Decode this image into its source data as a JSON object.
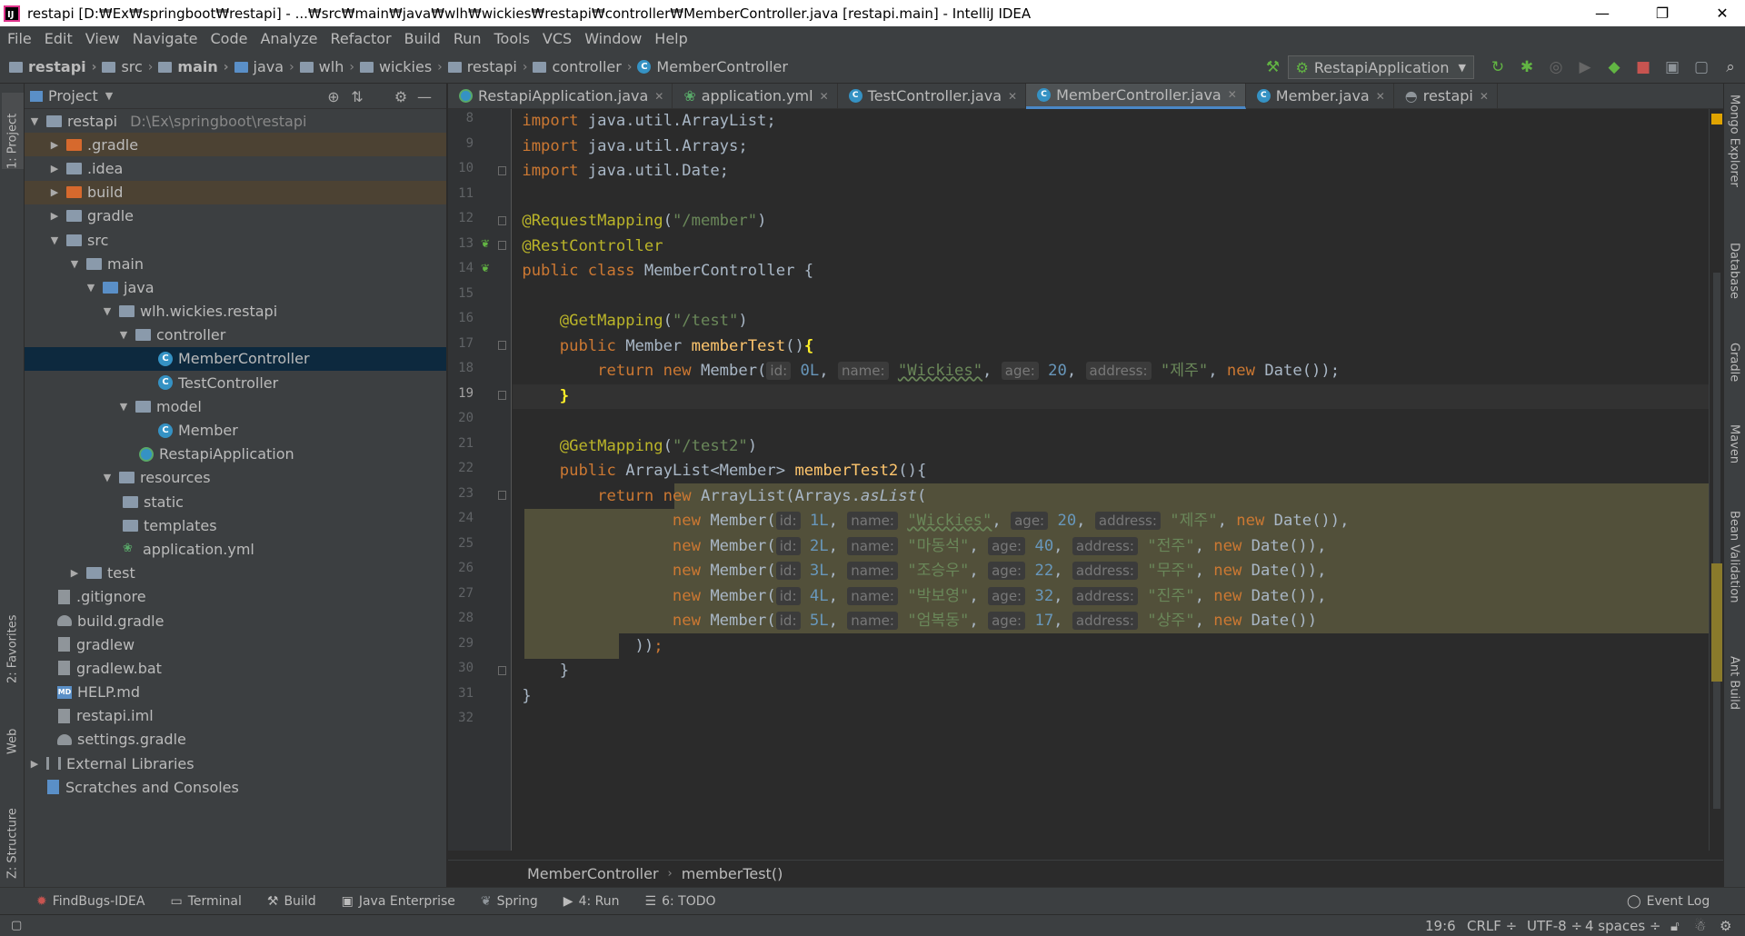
{
  "window": {
    "title": "restapi [D:₩Ex₩springboot₩restapi] - ...₩src₩main₩java₩wlh₩wickies₩restapi₩controller₩MemberController.java [restapi.main] - IntelliJ IDEA",
    "minimize": "—",
    "maximize": "❐",
    "close": "✕"
  },
  "menu": [
    "File",
    "Edit",
    "View",
    "Navigate",
    "Code",
    "Analyze",
    "Refactor",
    "Build",
    "Run",
    "Tools",
    "VCS",
    "Window",
    "Help"
  ],
  "nav_breadcrumb": [
    "restapi",
    "src",
    "main",
    "java",
    "wlh",
    "wickies",
    "restapi",
    "controller",
    "MemberController"
  ],
  "run_config": "RestapiApplication",
  "project_panel": {
    "title": "Project",
    "tree": [
      {
        "label": "restapi",
        "path": "D:\\Ex\\springboot\\restapi"
      },
      {
        "label": ".gradle"
      },
      {
        "label": ".idea"
      },
      {
        "label": "build"
      },
      {
        "label": "gradle"
      },
      {
        "label": "src"
      },
      {
        "label": "main"
      },
      {
        "label": "java"
      },
      {
        "label": "wlh.wickies.restapi"
      },
      {
        "label": "controller"
      },
      {
        "label": "MemberController"
      },
      {
        "label": "TestController"
      },
      {
        "label": "model"
      },
      {
        "label": "Member"
      },
      {
        "label": "RestapiApplication"
      },
      {
        "label": "resources"
      },
      {
        "label": "static"
      },
      {
        "label": "templates"
      },
      {
        "label": "application.yml"
      },
      {
        "label": "test"
      },
      {
        "label": ".gitignore"
      },
      {
        "label": "build.gradle"
      },
      {
        "label": "gradlew"
      },
      {
        "label": "gradlew.bat"
      },
      {
        "label": "HELP.md"
      },
      {
        "label": "restapi.iml"
      },
      {
        "label": "settings.gradle"
      },
      {
        "label": "External Libraries"
      },
      {
        "label": "Scratches and Consoles"
      }
    ]
  },
  "left_tabs": [
    "1: Project",
    "2: Favorites",
    "Web",
    "Z: Structure"
  ],
  "right_tabs": [
    "Mongo Explorer",
    "Database",
    "Gradle",
    "Maven",
    "Bean Validation",
    "Ant Build"
  ],
  "editor_tabs": [
    "RestapiApplication.java",
    "application.yml",
    "TestController.java",
    "MemberController.java",
    "Member.java",
    "restapi"
  ],
  "line_numbers": [
    "8",
    "9",
    "10",
    "11",
    "12",
    "13",
    "14",
    "15",
    "16",
    "17",
    "18",
    "19",
    "20",
    "21",
    "22",
    "23",
    "24",
    "25",
    "26",
    "27",
    "28",
    "29",
    "30",
    "31",
    "32"
  ],
  "code": {
    "l8": [
      "import",
      " java.util.ArrayList;"
    ],
    "l9": [
      "import",
      " java.util.Arrays;"
    ],
    "l10": [
      "import",
      " java.util.Date;"
    ],
    "l12": [
      "@RequestMapping",
      "(",
      "\"/member\"",
      ")"
    ],
    "l13": "@RestController",
    "l14": [
      "public class",
      " MemberController {"
    ],
    "l16": [
      "@GetMapping",
      "(",
      "\"/test\"",
      ")"
    ],
    "l17": [
      "public",
      " Member ",
      "memberTest",
      "()",
      "{"
    ],
    "l18": [
      "return new",
      " Member(",
      "id:",
      "0L",
      ",",
      "name:",
      "\"Wickies\"",
      ",",
      "age:",
      "20",
      ",",
      "address:",
      "\"제주\"",
      ", ",
      "new",
      " Date());"
    ],
    "l19": "}",
    "l21": [
      "@GetMapping",
      "(",
      "\"/test2\"",
      ")"
    ],
    "l22": [
      "public",
      " ArrayList<Member> ",
      "memberTest2",
      "(){"
    ],
    "l23": [
      "return",
      "new",
      " ArrayList(Arrays.",
      "asList",
      "("
    ],
    "members": [
      {
        "id": "1L",
        "name": "\"Wickies\"",
        "age": "20",
        "address": "\"제주\"",
        "end": "),"
      },
      {
        "id": "2L",
        "name": "\"마동석\"",
        "age": "40",
        "address": "\"전주\"",
        "end": "),"
      },
      {
        "id": "3L",
        "name": "\"조승우\"",
        "age": "22",
        "address": "\"무주\"",
        "end": "),"
      },
      {
        "id": "4L",
        "name": "\"박보영\"",
        "age": "32",
        "address": "\"진주\"",
        "end": "),"
      },
      {
        "id": "5L",
        "name": "\"엄복동\"",
        "age": "17",
        "address": "\"상주\"",
        "end": ")"
      }
    ],
    "l29": [
      "))",
      ";"
    ],
    "l30": "}",
    "l31": "}",
    "hint_labels": {
      "id": "id:",
      "name": "name:",
      "age": "age:",
      "address": "address:"
    },
    "new_kw": "new",
    "member_ctor": " Member(",
    "date_ctor": " Date()",
    "comma": ","
  },
  "editor_breadcrumb": [
    "MemberController",
    "memberTest()"
  ],
  "bottom_tools": [
    "FindBugs-IDEA",
    "Terminal",
    "Build",
    "Java Enterprise",
    "Spring",
    "4: Run",
    "6: TODO",
    "Event Log"
  ],
  "status": {
    "position": "19:6",
    "line_sep": "CRLF ÷",
    "encoding": "UTF-8 ÷",
    "indent": "4 spaces ÷"
  }
}
